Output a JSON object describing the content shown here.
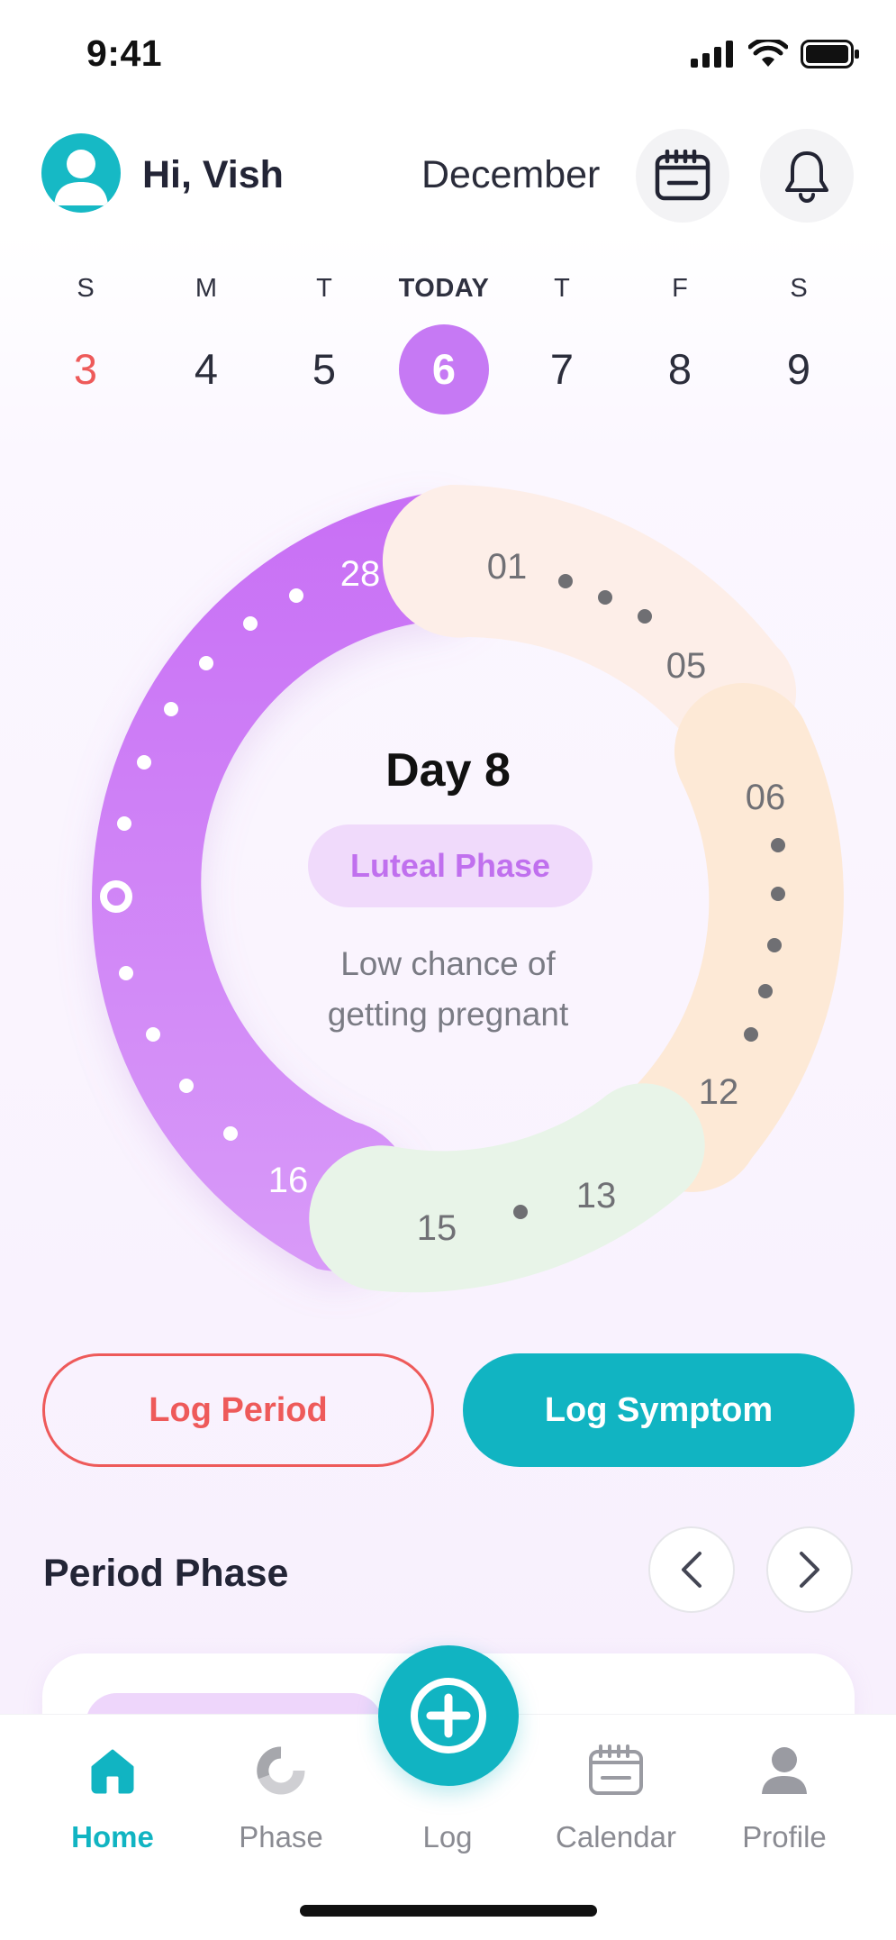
{
  "status_bar": {
    "time": "9:41"
  },
  "header": {
    "greeting": "Hi, Vish",
    "month": "December"
  },
  "week": {
    "days": [
      {
        "letter": "S",
        "date": "3"
      },
      {
        "letter": "M",
        "date": "4"
      },
      {
        "letter": "T",
        "date": "5"
      },
      {
        "letter": "TODAY",
        "date": "6"
      },
      {
        "letter": "T",
        "date": "7"
      },
      {
        "letter": "F",
        "date": "8"
      },
      {
        "letter": "S",
        "date": "9"
      }
    ]
  },
  "cycle": {
    "day_label": "Day 8",
    "phase": "Luteal Phase",
    "chance_line1": "Low chance of",
    "chance_line2": "getting pregnant",
    "segment_labels": {
      "luteal_start": "16",
      "luteal_end": "28",
      "period_start": "01",
      "period_end": "05",
      "follicular_start": "06",
      "follicular_end": "12",
      "ovulation_start": "13",
      "ovulation_end": "15"
    },
    "colors": {
      "luteal": "#c679f4",
      "period": "#fdeee8",
      "follicular": "#fde9d6",
      "ovulation": "#e8f4e8"
    }
  },
  "actions": {
    "log_period": "Log Period",
    "log_symptom": "Log Symptom"
  },
  "section": {
    "title": "Period Phase"
  },
  "tabs": {
    "home": "Home",
    "phase": "Phase",
    "log": "Log",
    "calendar": "Calendar",
    "profile": "Profile"
  },
  "accent_color": "#11b4c2"
}
